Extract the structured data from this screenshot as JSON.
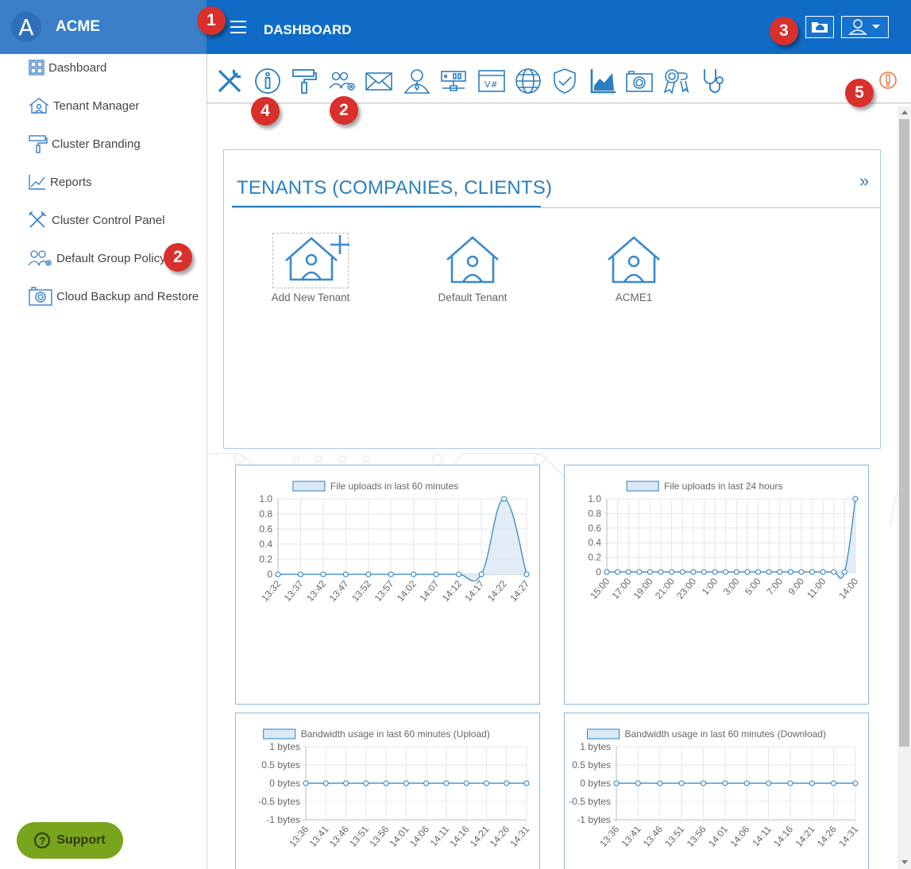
{
  "app": {
    "brand_letter": "A",
    "brand_name": "ACME",
    "page_title": "DASHBOARD"
  },
  "colors": {
    "topbar": "#0f6bc6",
    "brand_bg": "#3a7fc8",
    "accent": "#2a7fc0",
    "support": "#79a51c",
    "marker": "#d9302c"
  },
  "sidebar": {
    "items": [
      {
        "label": "Dashboard",
        "icon": "grid-icon"
      },
      {
        "label": "Tenant Manager",
        "icon": "house-icon"
      },
      {
        "label": "Cluster Branding",
        "icon": "paint-roller-icon"
      },
      {
        "label": "Reports",
        "icon": "line-chart-icon"
      },
      {
        "label": "Cluster Control Panel",
        "icon": "tools-icon"
      },
      {
        "label": "Default Group Policy",
        "icon": "group-settings-icon"
      },
      {
        "label": "Cloud Backup and Restore",
        "icon": "camera-icon"
      }
    ],
    "support_label": "Support"
  },
  "toolbar": {
    "icons": [
      "tools-icon",
      "info-icon",
      "paint-roller-icon",
      "group-settings-icon",
      "mail-icon",
      "user-icon",
      "server-icon",
      "version-icon",
      "globe-icon",
      "shield-check-icon",
      "area-chart-icon",
      "camera-icon",
      "certificate-icon",
      "stethoscope-icon"
    ],
    "alert_icon": "alert-icon"
  },
  "markers": {
    "m1": "1",
    "m2": "2",
    "m3": "3",
    "m4": "4",
    "m5": "5"
  },
  "tenants": {
    "title": "TENANTS (COMPANIES, CLIENTS)",
    "expand": "»",
    "items": [
      {
        "label": "Add New Tenant"
      },
      {
        "label": "Default Tenant"
      },
      {
        "label": "ACME1"
      }
    ]
  },
  "chart_data": [
    {
      "type": "area",
      "title": "File uploads in last 60 minutes",
      "x": [
        "13:32",
        "13:37",
        "13:42",
        "13:47",
        "13:52",
        "13:57",
        "14:02",
        "14:07",
        "14:12",
        "14:17",
        "14:22",
        "14:27"
      ],
      "series": [
        {
          "name": "File uploads in last 60 minutes",
          "values": [
            0,
            0,
            0,
            0,
            0,
            0,
            0,
            0,
            0,
            0,
            1,
            0
          ]
        }
      ],
      "y_ticks": [
        "1.0",
        "0.8",
        "0.6",
        "0.4",
        "0.2",
        "0"
      ],
      "ylim": [
        0,
        1
      ]
    },
    {
      "type": "area",
      "title": "File uploads in last 24 hours",
      "x": [
        "15:00",
        "",
        "17:00",
        "",
        "19:00",
        "",
        "21:00",
        "",
        "23:00",
        "",
        "1:00",
        "",
        "3:00",
        "",
        "5:00",
        "",
        "7:00",
        "",
        "9:00",
        "",
        "11:00",
        "",
        "",
        "14:00"
      ],
      "series": [
        {
          "name": "File uploads in last 24 hours",
          "values": [
            0,
            0,
            0,
            0,
            0,
            0,
            0,
            0,
            0,
            0,
            0,
            0,
            0,
            0,
            0,
            0,
            0,
            0,
            0,
            0,
            0,
            0,
            0,
            1
          ]
        }
      ],
      "y_ticks": [
        "1.0",
        "0.8",
        "0.6",
        "0.4",
        "0.2",
        "0"
      ],
      "ylim": [
        0,
        1
      ]
    },
    {
      "type": "line",
      "title": "Bandwidth usage in last 60 minutes (Upload)",
      "x": [
        "13:36",
        "13:41",
        "13:46",
        "13:51",
        "13:56",
        "14:01",
        "14:06",
        "14:11",
        "14:16",
        "14:21",
        "14:26",
        "14:31"
      ],
      "series": [
        {
          "name": "Bandwidth usage in last 60 minutes (Upload)",
          "values": [
            0,
            0,
            0,
            0,
            0,
            0,
            0,
            0,
            0,
            0,
            0,
            0
          ]
        }
      ],
      "y_ticks": [
        "1 bytes",
        "0.5 bytes",
        "0 bytes",
        "-0.5 bytes",
        "-1 bytes"
      ],
      "ylim": [
        -1,
        1
      ]
    },
    {
      "type": "line",
      "title": "Bandwidth usage in last 60 minutes (Download)",
      "x": [
        "13:36",
        "13:41",
        "13:46",
        "13:51",
        "13:56",
        "14:01",
        "14:06",
        "14:11",
        "14:16",
        "14:21",
        "14:26",
        "14:31"
      ],
      "series": [
        {
          "name": "Bandwidth usage in last 60 minutes (Download)",
          "values": [
            0,
            0,
            0,
            0,
            0,
            0,
            0,
            0,
            0,
            0,
            0,
            0
          ]
        }
      ],
      "y_ticks": [
        "1 bytes",
        "0.5 bytes",
        "0 bytes",
        "-0.5 bytes",
        "-1 bytes"
      ],
      "ylim": [
        -1,
        1
      ]
    }
  ]
}
